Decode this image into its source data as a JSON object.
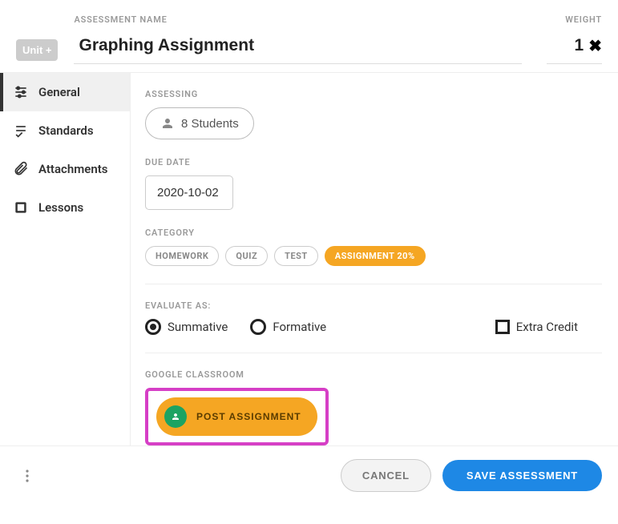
{
  "header": {
    "unit_button": "Unit +",
    "name_label": "ASSESSMENT NAME",
    "name_value": "Graphing Assignment",
    "weight_label": "WEIGHT",
    "weight_value": "1"
  },
  "sidebar": {
    "items": [
      {
        "label": "General",
        "icon": "sliders-icon",
        "active": true
      },
      {
        "label": "Standards",
        "icon": "checklist-icon",
        "active": false
      },
      {
        "label": "Attachments",
        "icon": "paperclip-icon",
        "active": false
      },
      {
        "label": "Lessons",
        "icon": "book-icon",
        "active": false
      }
    ]
  },
  "content": {
    "assessing": {
      "label": "ASSESSING",
      "value": "8 Students"
    },
    "due_date": {
      "label": "DUE DATE",
      "value": "2020-10-02"
    },
    "category": {
      "label": "CATEGORY",
      "options": [
        {
          "label": "HOMEWORK",
          "active": false
        },
        {
          "label": "QUIZ",
          "active": false
        },
        {
          "label": "TEST",
          "active": false
        },
        {
          "label": "ASSIGNMENT 20%",
          "active": true
        }
      ]
    },
    "evaluate": {
      "label": "EVALUATE AS:",
      "summative": "Summative",
      "formative": "Formative",
      "selected": "summative",
      "extra_credit": "Extra Credit"
    },
    "google_classroom": {
      "label": "GOOGLE CLASSROOM",
      "button": "POST ASSIGNMENT"
    }
  },
  "footer": {
    "cancel": "CANCEL",
    "save": "SAVE ASSESSMENT"
  }
}
